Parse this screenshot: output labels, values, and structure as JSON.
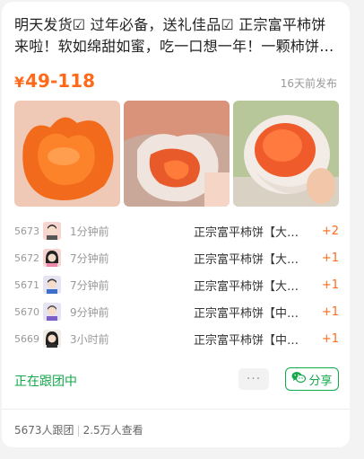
{
  "listing": {
    "title": "明天发货☑ 过年必备，送礼佳品☑ 正宗富平柿饼来啦！软如绵甜如蜜，吃一口想一年！一颗柿饼…",
    "price_symbol": "¥",
    "price_range": "49-118",
    "posted_time": "16天前发布"
  },
  "photos": [
    {
      "icon": "persimmon-cake-photo-1"
    },
    {
      "icon": "persimmon-cake-photo-2"
    },
    {
      "icon": "persimmon-cake-photo-3"
    }
  ],
  "orders": [
    {
      "num": "5673",
      "time": "1分钟前",
      "product": "正宗富平柿饼【大…",
      "qty": "+2"
    },
    {
      "num": "5672",
      "time": "7分钟前",
      "product": "正宗富平柿饼【大…",
      "qty": "+1"
    },
    {
      "num": "5671",
      "time": "7分钟前",
      "product": "正宗富平柿饼【大…",
      "qty": "+1"
    },
    {
      "num": "5670",
      "time": "9分钟前",
      "product": "正宗富平柿饼【中…",
      "qty": "+1"
    },
    {
      "num": "5669",
      "time": "3小时前",
      "product": "正宗富平柿饼【中…",
      "qty": "+1"
    }
  ],
  "actions": {
    "following_label": "正在跟团中",
    "more_label": "···",
    "share_label": "分享"
  },
  "footer": {
    "joined": "5673人跟团",
    "views": "2.5万人查看"
  },
  "colors": {
    "accent": "#ff6a1a",
    "green": "#13a84a"
  }
}
